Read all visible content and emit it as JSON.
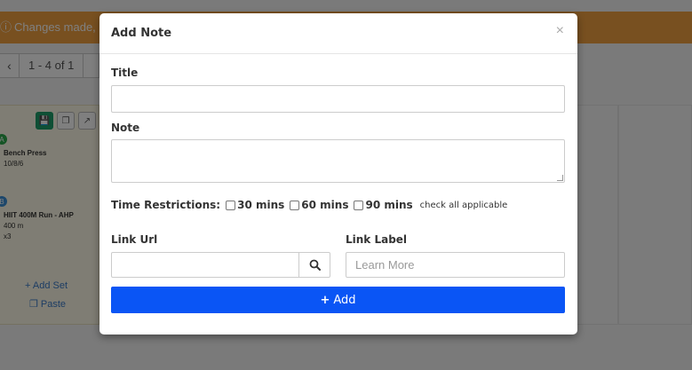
{
  "background": {
    "banner_text": "Changes made, n",
    "pager_range": "1 - 4 of 1",
    "exercises": [
      {
        "badge": "A",
        "name": "Bench Press",
        "detail": "10/8/6",
        "detail2": ""
      },
      {
        "badge": "B",
        "name": "HIIT 400M Run - AHP",
        "detail": "400 m",
        "detail2": "x3"
      }
    ],
    "add_set_label": "Add Set",
    "paste_label": "Paste"
  },
  "modal": {
    "title": "Add Note",
    "close_symbol": "×",
    "title_label": "Title",
    "note_label": "Note",
    "time_restrictions_label": "Time Restrictions:",
    "time_options": [
      "30 mins",
      "60 mins",
      "90 mins"
    ],
    "time_hint": "check all applicable",
    "link_url_label": "Link Url",
    "link_label_label": "Link Label",
    "link_label_placeholder": "Learn More",
    "add_button_label": "Add",
    "title_value": "",
    "note_value": "",
    "link_url_value": ""
  },
  "colors": {
    "banner": "#f0a040",
    "primary_button": "#0a55f5",
    "save_tool": "#1e9e6a",
    "badge_a": "#2aa84a",
    "badge_b": "#3a8fd6"
  },
  "icons": {
    "close": "close-icon",
    "search": "search-icon",
    "plus": "plus-icon",
    "info": "info-icon",
    "chevron_left": "chevron-left-icon"
  }
}
